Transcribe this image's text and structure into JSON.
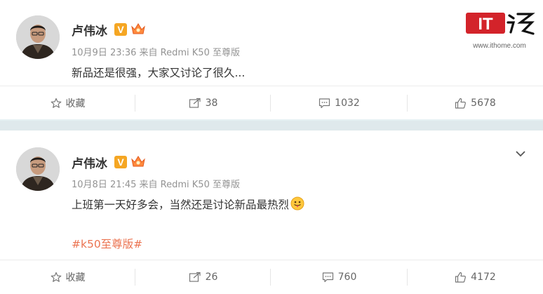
{
  "posts": [
    {
      "name": "卢伟冰",
      "v_badge": "V",
      "meta": "10月9日 23:36 来自 Redmi K50 至尊版",
      "text": "新品还是很强，大家又讨论了很久...",
      "topic": "",
      "actions": {
        "favorite": "收藏",
        "repost": "38",
        "comment": "1032",
        "like": "5678"
      }
    },
    {
      "name": "卢伟冰",
      "v_badge": "V",
      "meta": "10月8日 21:45 来自 Redmi K50 至尊版",
      "text": "上班第一天好多会，当然还是讨论新品最热烈",
      "topic": "#k50至尊版#",
      "actions": {
        "favorite": "收藏",
        "repost": "26",
        "comment": "760",
        "like": "4172"
      }
    }
  ],
  "watermark": {
    "logo_text": "IT之家",
    "url": "www.ithome.com"
  },
  "colors": {
    "topic": "#eb7350",
    "badge": "#f5a623",
    "divider": "#dfe9ec"
  }
}
